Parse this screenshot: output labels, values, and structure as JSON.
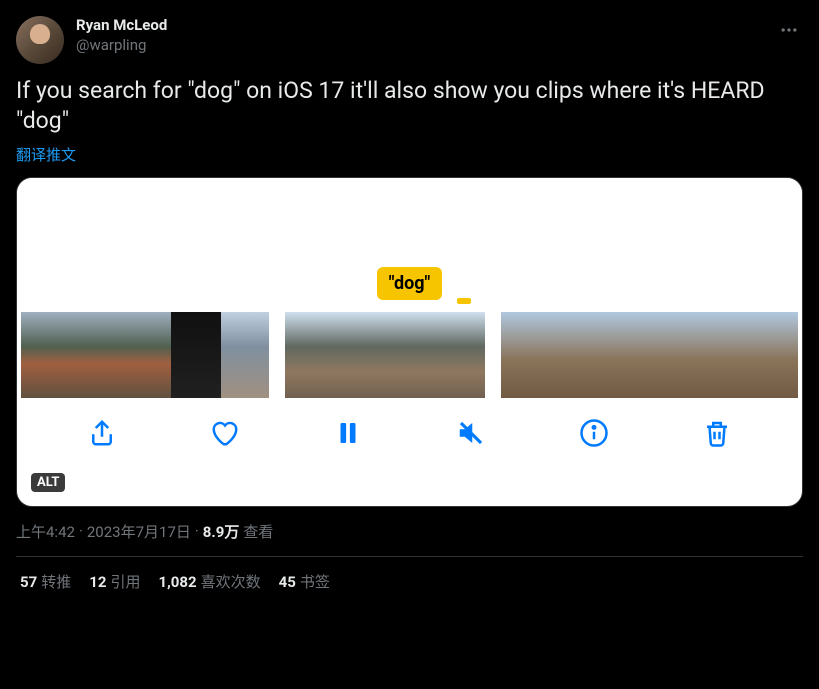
{
  "user": {
    "display_name": "Ryan McLeod",
    "handle": "@warpling"
  },
  "tweet": {
    "text": "If you search for \"dog\" on iOS 17 it'll also show you clips where it's HEARD \"dog\"",
    "translate_label": "翻译推文",
    "media": {
      "search_label": "\"dog\"",
      "alt_badge": "ALT"
    }
  },
  "meta": {
    "time": "上午4:42",
    "separator1": " · ",
    "date": "2023年7月17日",
    "separator2": " · ",
    "views_count": "8.9万",
    "views_label": " 查看"
  },
  "stats": {
    "retweets_count": "57",
    "retweets_label": "转推",
    "quotes_count": "12",
    "quotes_label": "引用",
    "likes_count": "1,082",
    "likes_label": "喜欢次数",
    "bookmarks_count": "45",
    "bookmarks_label": "书签"
  }
}
